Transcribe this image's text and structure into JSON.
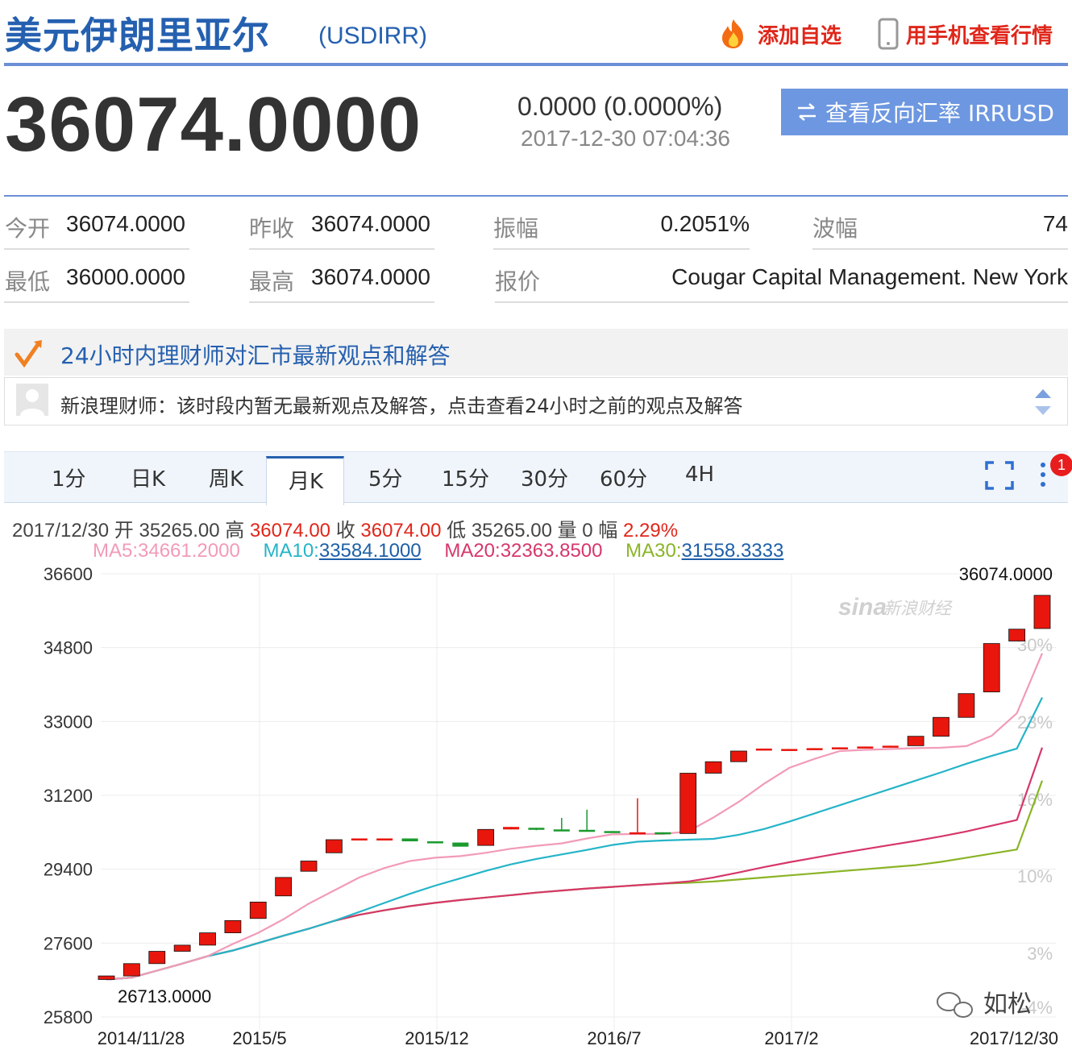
{
  "header": {
    "title": "美元伊朗里亚尔",
    "code": "(USDIRR)",
    "add_watch": "添加自选",
    "mobile_view": "用手机查看行情"
  },
  "quote": {
    "price": "36074.0000",
    "change": "0.0000 (0.0000%)",
    "time": "2017-12-30 07:04:36",
    "reverse_button": "查看反向汇率 IRRUSD"
  },
  "stats": {
    "open_label": "今开",
    "open": "36074.0000",
    "prev_label": "昨收",
    "prev": "36074.0000",
    "amp_label": "振幅",
    "amp": "0.2051%",
    "wave_label": "波幅",
    "wave": "74",
    "low_label": "最低",
    "low": "36000.0000",
    "high_label": "最高",
    "high": "36074.0000",
    "quote_label": "报价",
    "quote_src": "Cougar Capital Management. New York"
  },
  "advisor": {
    "title": "24小时内理财师对汇市最新观点和解答",
    "text": "新浪理财师：该时段内暂无最新观点及解答，点击查看24小时之前的观点及解答"
  },
  "tabs": [
    "1分",
    "日K",
    "周K",
    "月K",
    "5分",
    "15分",
    "30分",
    "60分",
    "4H"
  ],
  "active_tab": "月K",
  "badge": "1",
  "info": {
    "date": "2017/12/30",
    "open_lbl": "开",
    "open": "35265.00",
    "high_lbl": "高",
    "high": "36074.00",
    "close_lbl": "收",
    "close": "36074.00",
    "low_lbl": "低",
    "low": "35265.00",
    "vol_lbl": "量",
    "vol": "0",
    "amp_lbl": "幅",
    "amp": "2.29%"
  },
  "ma": {
    "ma5_label": "MA5:",
    "ma5": "34661.2000",
    "ma10_label": "MA10:",
    "ma10": "33584.1000",
    "ma20_label": "MA20:",
    "ma20": "32363.8500",
    "ma30_label": "MA30:",
    "ma30": "31558.3333"
  },
  "colors": {
    "up": "#e8160c",
    "down": "#1a9a2e",
    "ma5": "#f29bb8",
    "ma10": "#25b4c8",
    "ma20": "#d63769",
    "ma30": "#8ab426",
    "accent": "#2560b0"
  },
  "watermark": {
    "brand": "新浪财经",
    "wechat": "如松"
  },
  "chart_data": {
    "type": "candlestick",
    "y_ticks": [
      36600,
      34800,
      33000,
      31200,
      29400,
      27600,
      25800
    ],
    "ylim": [
      25800,
      36600
    ],
    "pct_ticks": [
      "30%",
      "23%",
      "16%",
      "10%",
      "3%",
      "-4%"
    ],
    "x_ticks": [
      "2014/11/28",
      "2015/5",
      "2015/12",
      "2016/7",
      "2017/2",
      "2017/12/30"
    ],
    "max_label": "36074.0000",
    "min_label": "26713.0000",
    "candles": [
      {
        "o": 26713,
        "c": 26800,
        "h": 26800,
        "l": 26713
      },
      {
        "o": 26800,
        "c": 27100,
        "h": 27100,
        "l": 26800
      },
      {
        "o": 27100,
        "c": 27400,
        "h": 27400,
        "l": 27100
      },
      {
        "o": 27400,
        "c": 27550,
        "h": 27550,
        "l": 27400
      },
      {
        "o": 27550,
        "c": 27850,
        "h": 27850,
        "l": 27550
      },
      {
        "o": 27850,
        "c": 28150,
        "h": 28150,
        "l": 27850
      },
      {
        "o": 28200,
        "c": 28600,
        "h": 28600,
        "l": 28200
      },
      {
        "o": 28750,
        "c": 29200,
        "h": 29200,
        "l": 28750
      },
      {
        "o": 29350,
        "c": 29600,
        "h": 29600,
        "l": 29350
      },
      {
        "o": 29800,
        "c": 30120,
        "h": 30120,
        "l": 29800
      },
      {
        "o": 30150,
        "c": 30150,
        "h": 30150,
        "l": 30150
      },
      {
        "o": 30150,
        "c": 30150,
        "h": 30150,
        "l": 30150
      },
      {
        "o": 30150,
        "c": 30080,
        "h": 30150,
        "l": 30080
      },
      {
        "o": 30080,
        "c": 30050,
        "h": 30080,
        "l": 30050
      },
      {
        "o": 30050,
        "c": 29950,
        "h": 30050,
        "l": 29950
      },
      {
        "o": 29980,
        "c": 30370,
        "h": 30370,
        "l": 29980
      },
      {
        "o": 30370,
        "c": 30430,
        "h": 30430,
        "l": 30370
      },
      {
        "o": 30410,
        "c": 30360,
        "h": 30410,
        "l": 30350
      },
      {
        "o": 30370,
        "c": 30330,
        "h": 30650,
        "l": 30330
      },
      {
        "o": 30360,
        "c": 30330,
        "h": 30850,
        "l": 30330
      },
      {
        "o": 30330,
        "c": 30300,
        "h": 30330,
        "l": 30300
      },
      {
        "o": 30300,
        "c": 30300,
        "h": 31130,
        "l": 30300
      },
      {
        "o": 30300,
        "c": 30280,
        "h": 30300,
        "l": 30280
      },
      {
        "o": 30270,
        "c": 31740,
        "h": 31740,
        "l": 30270
      },
      {
        "o": 31740,
        "c": 32020,
        "h": 32020,
        "l": 31740
      },
      {
        "o": 32020,
        "c": 32280,
        "h": 32280,
        "l": 32020
      },
      {
        "o": 32310,
        "c": 32340,
        "h": 32340,
        "l": 32310
      },
      {
        "o": 32300,
        "c": 32330,
        "h": 32330,
        "l": 32300
      },
      {
        "o": 32320,
        "c": 32350,
        "h": 32350,
        "l": 32320
      },
      {
        "o": 32350,
        "c": 32370,
        "h": 32370,
        "l": 32350
      },
      {
        "o": 32370,
        "c": 32390,
        "h": 32390,
        "l": 32370
      },
      {
        "o": 32390,
        "c": 32410,
        "h": 32410,
        "l": 32390
      },
      {
        "o": 32410,
        "c": 32640,
        "h": 32640,
        "l": 32410
      },
      {
        "o": 32640,
        "c": 33100,
        "h": 33100,
        "l": 32640
      },
      {
        "o": 33100,
        "c": 33680,
        "h": 33680,
        "l": 33100
      },
      {
        "o": 33720,
        "c": 34900,
        "h": 34900,
        "l": 33720
      },
      {
        "o": 34960,
        "c": 35250,
        "h": 35250,
        "l": 34960
      },
      {
        "o": 35265,
        "c": 36074,
        "h": 36074,
        "l": 35265
      }
    ],
    "series": [
      {
        "name": "MA5",
        "values": [
          26713,
          26760,
          26930,
          27100,
          27280,
          27580,
          27850,
          28180,
          28560,
          28880,
          29200,
          29430,
          29600,
          29680,
          29720,
          29800,
          29900,
          29970,
          30030,
          30150,
          30250,
          30260,
          30260,
          30320,
          30660,
          31040,
          31480,
          31870,
          32090,
          32280,
          32310,
          32330,
          32350,
          32360,
          32400,
          32650,
          33200,
          34661
        ]
      },
      {
        "name": "MA10",
        "values": [
          26713,
          26760,
          26930,
          27100,
          27280,
          27420,
          27600,
          27780,
          27950,
          28140,
          28360,
          28580,
          28800,
          29000,
          29180,
          29360,
          29520,
          29650,
          29760,
          29870,
          29990,
          30070,
          30100,
          30120,
          30140,
          30240,
          30380,
          30560,
          30760,
          30960,
          31160,
          31360,
          31560,
          31760,
          31970,
          32160,
          32340,
          33584
        ]
      },
      {
        "name": "MA20",
        "values": [
          26713,
          26760,
          26930,
          27100,
          27280,
          27420,
          27600,
          27780,
          27950,
          28140,
          28290,
          28400,
          28500,
          28580,
          28650,
          28710,
          28770,
          28830,
          28880,
          28930,
          28970,
          29010,
          29050,
          29100,
          29200,
          29320,
          29450,
          29570,
          29680,
          29790,
          29890,
          29990,
          30090,
          30200,
          30320,
          30460,
          30600,
          32363
        ]
      },
      {
        "name": "MA30",
        "values": [
          26713,
          26760,
          26930,
          27100,
          27280,
          27420,
          27600,
          27780,
          27950,
          28140,
          28290,
          28400,
          28500,
          28580,
          28650,
          28710,
          28770,
          28830,
          28880,
          28930,
          28970,
          29010,
          29050,
          29070,
          29100,
          29150,
          29200,
          29250,
          29300,
          29350,
          29400,
          29450,
          29500,
          29580,
          29680,
          29780,
          29880,
          31558
        ]
      }
    ]
  }
}
